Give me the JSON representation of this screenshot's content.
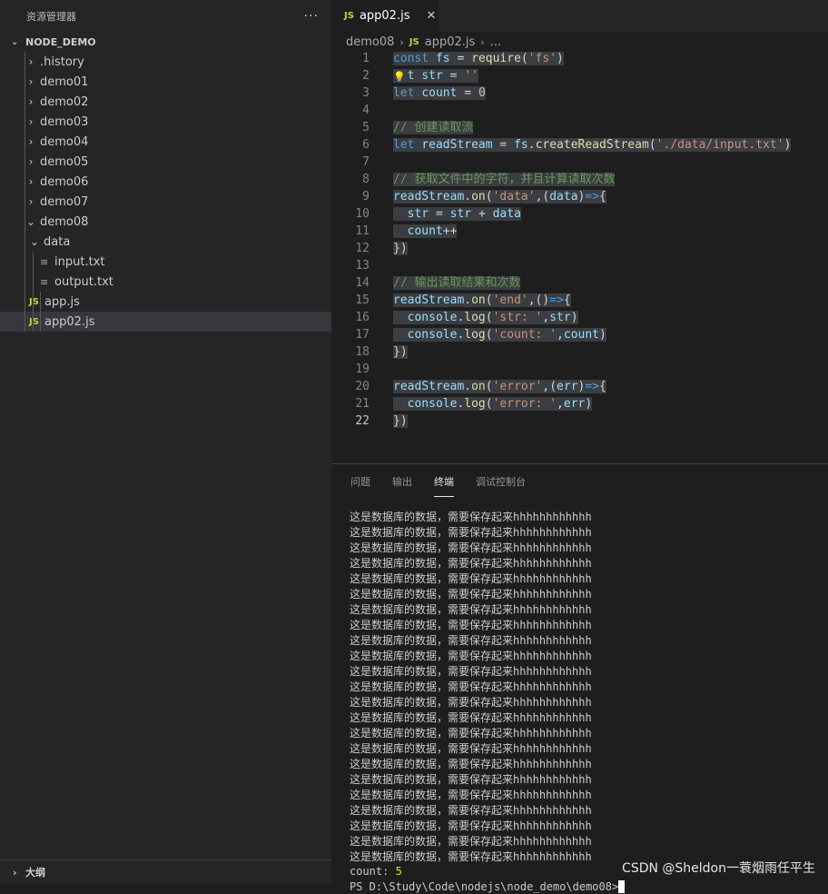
{
  "explorer": {
    "title": "资源管理器",
    "more": "···",
    "project": "NODE_DEMO",
    "items": [
      {
        "label": ".history",
        "type": "folder",
        "depth": 1
      },
      {
        "label": "demo01",
        "type": "folder",
        "depth": 1
      },
      {
        "label": "demo02",
        "type": "folder",
        "depth": 1
      },
      {
        "label": "demo03",
        "type": "folder",
        "depth": 1
      },
      {
        "label": "demo04",
        "type": "folder",
        "depth": 1
      },
      {
        "label": "demo05",
        "type": "folder",
        "depth": 1
      },
      {
        "label": "demo06",
        "type": "folder",
        "depth": 1
      },
      {
        "label": "demo07",
        "type": "folder",
        "depth": 1
      },
      {
        "label": "demo08",
        "type": "folder-open",
        "depth": 1
      },
      {
        "label": "data",
        "type": "folder-open",
        "depth": 2
      },
      {
        "label": "input.txt",
        "type": "txt",
        "depth": 3
      },
      {
        "label": "output.txt",
        "type": "txt",
        "depth": 3
      },
      {
        "label": "app.js",
        "type": "js",
        "depth": 2
      },
      {
        "label": "app02.js",
        "type": "js",
        "depth": 2,
        "selected": true
      }
    ],
    "outline": "大纲"
  },
  "tab": {
    "icon": "JS",
    "label": "app02.js",
    "close": "✕"
  },
  "breadcrumbs": {
    "folder": "demo08",
    "icon": "JS",
    "file": "app02.js",
    "rest": "..."
  },
  "code": {
    "lines": [
      "1",
      "2",
      "3",
      "4",
      "5",
      "6",
      "7",
      "8",
      "9",
      "10",
      "11",
      "12",
      "13",
      "14",
      "15",
      "16",
      "17",
      "18",
      "19",
      "20",
      "21",
      "22"
    ]
  },
  "panel": {
    "tabs": [
      "问题",
      "输出",
      "终端",
      "调试控制台"
    ],
    "active_tab": "终端",
    "output_line": "这是数据库的数据，需要保存起来hhhhhhhhhhhh",
    "count_label": "count:",
    "count_value": "5",
    "prompt": "PS D:\\Study\\Code\\nodejs\\node_demo\\demo08>"
  },
  "watermark": "CSDN @Sheldon一蓑烟雨任平生",
  "colors": {
    "keyword": "#569cd6",
    "string": "#ce9178",
    "comment": "#6a9955",
    "function": "#dcdcaa",
    "variable": "#9cdcfe"
  }
}
